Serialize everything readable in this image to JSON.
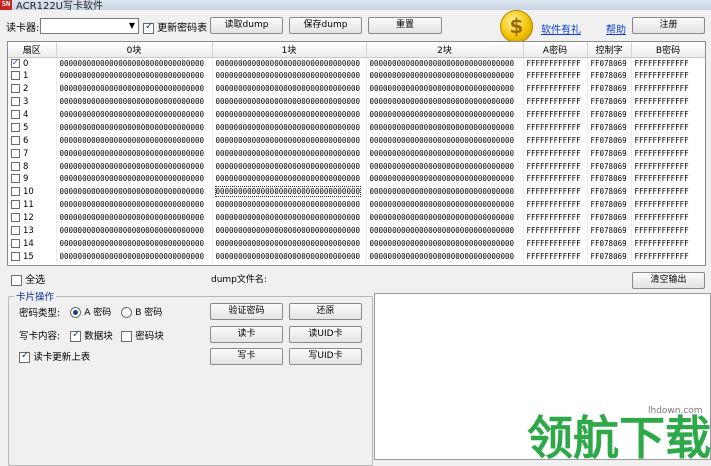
{
  "window": {
    "title": "ACR122U写卡软件",
    "app_icon": "SN"
  },
  "toolbar": {
    "reader_label": "读卡器:",
    "reader_value": "",
    "update_key_table_label": "更新密码表",
    "update_key_table_checked": true,
    "read_dump_label": "读取dump",
    "save_dump_label": "保存dump",
    "reset_label": "重置",
    "software_gift_label": "软件有礼",
    "help_label": "帮助",
    "register_label": "注册"
  },
  "grid": {
    "headers": [
      "扇区",
      "0块",
      "1块",
      "2块",
      "A密码",
      "控制字",
      "B密码"
    ],
    "rows": [
      {
        "sector": "0",
        "checked": true,
        "b0": "00000000000000000000000000000000",
        "b1": "00000000000000000000000000000000",
        "b2": "00000000000000000000000000000000",
        "keyA": "FFFFFFFFFFFF",
        "ctrl": "FF078069",
        "keyB": "FFFFFFFFFFFF"
      },
      {
        "sector": "1",
        "checked": false,
        "b0": "00000000000000000000000000000000",
        "b1": "00000000000000000000000000000000",
        "b2": "00000000000000000000000000000000",
        "keyA": "FFFFFFFFFFFF",
        "ctrl": "FF078069",
        "keyB": "FFFFFFFFFFFF"
      },
      {
        "sector": "2",
        "checked": false,
        "b0": "00000000000000000000000000000000",
        "b1": "00000000000000000000000000000000",
        "b2": "00000000000000000000000000000000",
        "keyA": "FFFFFFFFFFFF",
        "ctrl": "FF078069",
        "keyB": "FFFFFFFFFFFF"
      },
      {
        "sector": "3",
        "checked": false,
        "b0": "00000000000000000000000000000000",
        "b1": "00000000000000000000000000000000",
        "b2": "00000000000000000000000000000000",
        "keyA": "FFFFFFFFFFFF",
        "ctrl": "FF078069",
        "keyB": "FFFFFFFFFFFF"
      },
      {
        "sector": "4",
        "checked": false,
        "b0": "00000000000000000000000000000000",
        "b1": "00000000000000000000000000000000",
        "b2": "00000000000000000000000000000000",
        "keyA": "FFFFFFFFFFFF",
        "ctrl": "FF078069",
        "keyB": "FFFFFFFFFFFF"
      },
      {
        "sector": "5",
        "checked": false,
        "b0": "00000000000000000000000000000000",
        "b1": "00000000000000000000000000000000",
        "b2": "00000000000000000000000000000000",
        "keyA": "FFFFFFFFFFFF",
        "ctrl": "FF078069",
        "keyB": "FFFFFFFFFFFF"
      },
      {
        "sector": "6",
        "checked": false,
        "b0": "00000000000000000000000000000000",
        "b1": "00000000000000000000000000000000",
        "b2": "00000000000000000000000000000000",
        "keyA": "FFFFFFFFFFFF",
        "ctrl": "FF078069",
        "keyB": "FFFFFFFFFFFF"
      },
      {
        "sector": "7",
        "checked": false,
        "b0": "00000000000000000000000000000000",
        "b1": "00000000000000000000000000000000",
        "b2": "00000000000000000000000000000000",
        "keyA": "FFFFFFFFFFFF",
        "ctrl": "FF078069",
        "keyB": "FFFFFFFFFFFF"
      },
      {
        "sector": "8",
        "checked": false,
        "b0": "00000000000000000000000000000000",
        "b1": "00000000000000000000000000000000",
        "b2": "00000000000000000000000000000000",
        "keyA": "FFFFFFFFFFFF",
        "ctrl": "FF078069",
        "keyB": "FFFFFFFFFFFF"
      },
      {
        "sector": "9",
        "checked": false,
        "b0": "00000000000000000000000000000000",
        "b1": "00000000000000000000000000000000",
        "b2": "00000000000000000000000000000000",
        "keyA": "FFFFFFFFFFFF",
        "ctrl": "FF078069",
        "keyB": "FFFFFFFFFFFF"
      },
      {
        "sector": "10",
        "checked": false,
        "b0": "00000000000000000000000000000000",
        "b1": "00000000000000000000000000000000",
        "b2": "00000000000000000000000000000000",
        "keyA": "FFFFFFFFFFFF",
        "ctrl": "FF078069",
        "keyB": "FFFFFFFFFFFF"
      },
      {
        "sector": "11",
        "checked": false,
        "b0": "00000000000000000000000000000000",
        "b1": "00000000000000000000000000000000",
        "b2": "00000000000000000000000000000000",
        "keyA": "FFFFFFFFFFFF",
        "ctrl": "FF078069",
        "keyB": "FFFFFFFFFFFF"
      },
      {
        "sector": "12",
        "checked": false,
        "b0": "00000000000000000000000000000000",
        "b1": "00000000000000000000000000000000",
        "b2": "00000000000000000000000000000000",
        "keyA": "FFFFFFFFFFFF",
        "ctrl": "FF078069",
        "keyB": "FFFFFFFFFFFF"
      },
      {
        "sector": "13",
        "checked": false,
        "b0": "00000000000000000000000000000000",
        "b1": "00000000000000000000000000000000",
        "b2": "00000000000000000000000000000000",
        "keyA": "FFFFFFFFFFFF",
        "ctrl": "FF078069",
        "keyB": "FFFFFFFFFFFF"
      },
      {
        "sector": "14",
        "checked": false,
        "b0": "00000000000000000000000000000000",
        "b1": "00000000000000000000000000000000",
        "b2": "00000000000000000000000000000000",
        "keyA": "FFFFFFFFFFFF",
        "ctrl": "FF078069",
        "keyB": "FFFFFFFFFFFF"
      },
      {
        "sector": "15",
        "checked": false,
        "b0": "00000000000000000000000000000000",
        "b1": "00000000000000000000000000000000",
        "b2": "00000000000000000000000000000000",
        "keyA": "FFFFFFFFFFFF",
        "ctrl": "FF078069",
        "keyB": "FFFFFFFFFFFF"
      }
    ]
  },
  "bottom": {
    "select_all_label": "全选",
    "select_all_checked": false,
    "dump_filename_label": "dump文件名:",
    "clear_output_label": "清空输出"
  },
  "card_ops": {
    "group_title": "卡片操作",
    "key_type_label": "密码类型:",
    "key_a_label": "A 密码",
    "key_b_label": "B 密码",
    "key_a_selected": true,
    "write_content_label": "写卡内容:",
    "data_block_label": "数据块",
    "data_block_checked": true,
    "key_block_label": "密码块",
    "key_block_checked": false,
    "refresh_after_read_label": "读卡更新上表",
    "refresh_after_read_checked": true,
    "verify_key_label": "验证密码",
    "restore_label": "还原",
    "read_card_label": "读卡",
    "read_uid_label": "读UID卡",
    "write_card_label": "写卡",
    "write_uid_label": "写UID卡"
  },
  "watermark": {
    "site": "lhdown.com",
    "brand": "领航下载",
    "color": "#2fa84a"
  },
  "colors": {
    "link": "#0a3fd1",
    "group_title": "#0c2f9b",
    "app_icon_bg": "#c8261f"
  }
}
